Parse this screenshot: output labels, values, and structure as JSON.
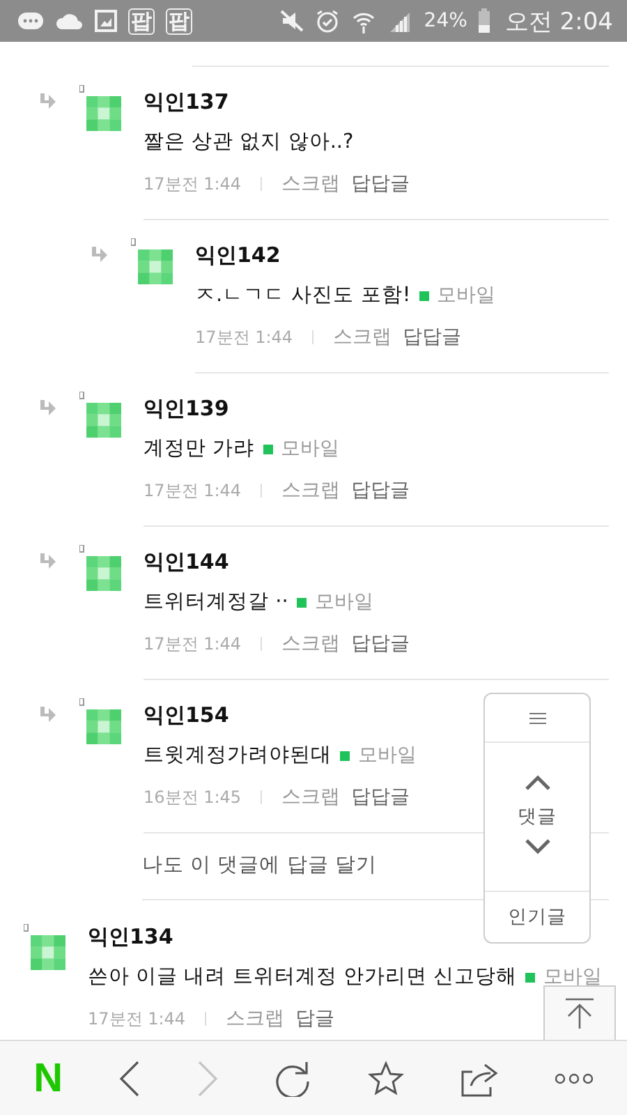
{
  "status_bar": {
    "app_icons": [
      "팝",
      "팝"
    ],
    "battery": "24%",
    "time": "오전 2:04"
  },
  "replies": [
    {
      "author": "익인137",
      "text": "짤은 상관 없지 않아..?",
      "time": "17분전 1:44",
      "scrap": "스크랩",
      "reply": "답답글",
      "children": [
        {
          "author": "익인142",
          "text": "ㅈ.ㄴㄱㄷ 사진도 포함!",
          "source": "모바일",
          "time": "17분전 1:44",
          "scrap": "스크랩",
          "reply": "답답글"
        }
      ]
    },
    {
      "author": "익인139",
      "text": "계정만 가랴",
      "source": "모바일",
      "time": "17분전 1:44",
      "scrap": "스크랩",
      "reply": "답답글"
    },
    {
      "author": "익인144",
      "text": "트위터계정갈 ··",
      "source": "모바일",
      "time": "17분전 1:44",
      "scrap": "스크랩",
      "reply": "답답글"
    },
    {
      "author": "익인154",
      "text": "트윗계정가려야된대",
      "source": "모바일",
      "time": "16분전 1:45",
      "scrap": "스크랩",
      "reply": "답답글"
    }
  ],
  "reply_prompt": "나도 이 댓글에 답글 달기",
  "comments": [
    {
      "author": "익인134",
      "text": "쓴아 이글 내려 트위터계정 안가리면 신고당해",
      "source": "모바일",
      "time": "17분전 1:44",
      "scrap": "스크랩",
      "reply": "답글"
    }
  ],
  "float_menu": {
    "label": "댓글",
    "popular": "인기글"
  },
  "bottom_bar": {
    "logo": "N",
    "forward_disabled": true
  }
}
